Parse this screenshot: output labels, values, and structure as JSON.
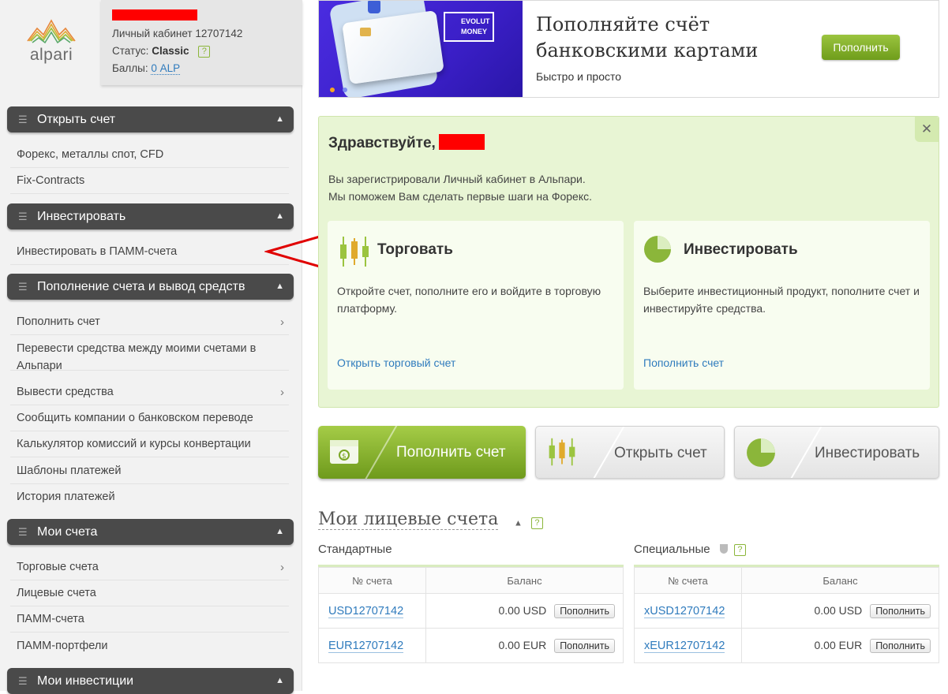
{
  "brand": {
    "logo_text": "alpari"
  },
  "user": {
    "cabinet_label": "Личный кабинет 12707142",
    "status_label": "Статус:",
    "status_value": "Classic",
    "points_label": "Баллы:",
    "points_value": "0 ALP",
    "help": "?"
  },
  "sidebar": {
    "sections": [
      {
        "title": "Открыть счет",
        "items": [
          "Форекс, металлы спот, CFD",
          "Fix-Contracts"
        ]
      },
      {
        "title": "Инвестировать",
        "items": [
          "Инвестировать в ПАММ-счета"
        ]
      },
      {
        "title": "Пополнение счета и вывод средств",
        "items": [
          "Пополнить счет",
          "Перевести средства между моими счетами в Альпари",
          "Вывести средства",
          "Сообщить компании о банковском переводе",
          "Калькулятор комиссий и курсы конвертации",
          "Шаблоны платежей",
          "История платежей"
        ]
      },
      {
        "title": "Мои счета",
        "items": [
          "Торговые счета",
          "Лицевые счета",
          "ПАММ-счета",
          "ПАММ-портфели"
        ]
      },
      {
        "title": "Мои инвестиции",
        "items": []
      }
    ]
  },
  "banner": {
    "title_line1": "Пополняйте счёт",
    "title_line2": "банковскими картами",
    "subtitle": "Быстро и просто",
    "button": "Пополнить",
    "art_text_line1": "EVOLUT",
    "art_text_line2": "MONEY"
  },
  "welcome": {
    "greeting": "Здравствуйте,",
    "line1": "Вы зарегистрировали Личный кабинет в Альпари.",
    "line2": "Мы поможем Вам сделать первые шаги на Форекс.",
    "close": "✕",
    "cards": [
      {
        "title": "Торговать",
        "text": "Откройте счет, пополните его и войдите в торговую платформу.",
        "link": "Открыть торговый счет"
      },
      {
        "title": "Инвестировать",
        "text": "Выберите инвестиционный продукт, пополните счет и инвестируйте средства.",
        "link": "Пополнить счет"
      }
    ]
  },
  "actions": {
    "deposit": "Пополнить счет",
    "open": "Открыть счет",
    "invest": "Инвестировать"
  },
  "accounts": {
    "title": "Мои лицевые счета",
    "toggle": "▲",
    "help": "?",
    "standard": {
      "title": "Стандартные",
      "headers": [
        "№ счета",
        "Баланс"
      ],
      "rows": [
        {
          "id": "USD12707142",
          "balance": "0.00 USD",
          "action": "Пополнить"
        },
        {
          "id": "EUR12707142",
          "balance": "0.00 EUR",
          "action": "Пополнить"
        }
      ]
    },
    "special": {
      "title": "Специальные",
      "headers": [
        "№ счета",
        "Баланс"
      ],
      "rows": [
        {
          "id": "xUSD12707142",
          "balance": "0.00 USD",
          "action": "Пополнить"
        },
        {
          "id": "xEUR12707142",
          "balance": "0.00 EUR",
          "action": "Пополнить"
        }
      ]
    }
  },
  "colors": {
    "accent_green": "#8bb63a",
    "link_blue": "#2f7bbd",
    "header_dark": "#4a4a4a",
    "arrow_red": "#e00000"
  }
}
